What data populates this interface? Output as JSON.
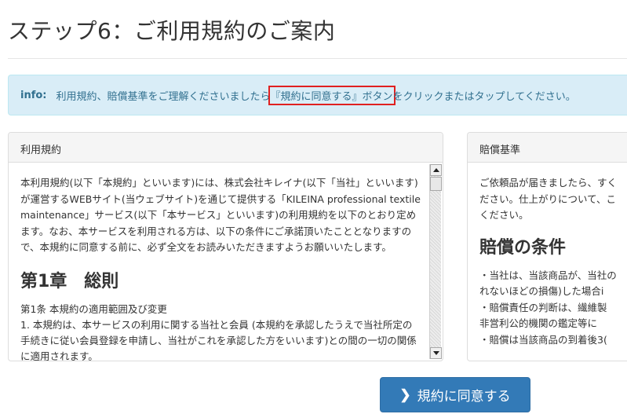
{
  "page": {
    "title": "ステップ6：ご利用規約のご案内"
  },
  "info": {
    "label": "info:",
    "text_before": "利用規約、賠償基準をご理解くださいましたら",
    "highlight": "『規約に同意する』ボタン",
    "text_after": "をクリックまたはタップしてください。"
  },
  "terms_panel": {
    "heading": "利用規約",
    "intro": "本利用規約(以下「本規約」といいます)には、株式会社キレイナ(以下「当社」といいます)が運営するWEBサイト(当ウェブサイト)を通じて提供する「KILEINA professional textile maintenance」サービス(以下「本サービス」といいます)の利用規約を以下のとおり定めます。なお、本サービスを利用される方は、以下の条件にご承諾頂いたこととなりますので、本規約に同意する前に、必ず全文をお読みいただきますようお願いいたします。",
    "chapter": "第1章　総則",
    "article": "第1条 本規約の適用範囲及び変更",
    "item1": "1. 本規約は、本サービスの利用に関する当社と会員 (本規約を承認したうえで当社所定の手続きに従い会員登録を申請し、当社がこれを承認した方をいいます)との間の一切の関係に適用されます。"
  },
  "compensation_panel": {
    "heading": "賠償基準",
    "intro_lines": [
      "ご依頼品が届きましたら、すく",
      "ださい。仕上がりについて、こ",
      "ください。"
    ],
    "title": "賠償の条件",
    "lines": [
      "・当社は、当該商品が、当社の",
      "れないほどの損傷)した場合i",
      "・賠償責任の判断は、繊維製",
      "非営利公的機関の鑑定等に",
      "・賠償は当該商品の到着後3("
    ]
  },
  "agree_button": {
    "label": "規約に同意する"
  },
  "colors": {
    "info_bg": "#d9edf7",
    "info_text": "#31708f",
    "button_bg": "#337ab7",
    "highlight_border": "#e02020"
  },
  "icons": {
    "button": "chevron-right-icon"
  }
}
